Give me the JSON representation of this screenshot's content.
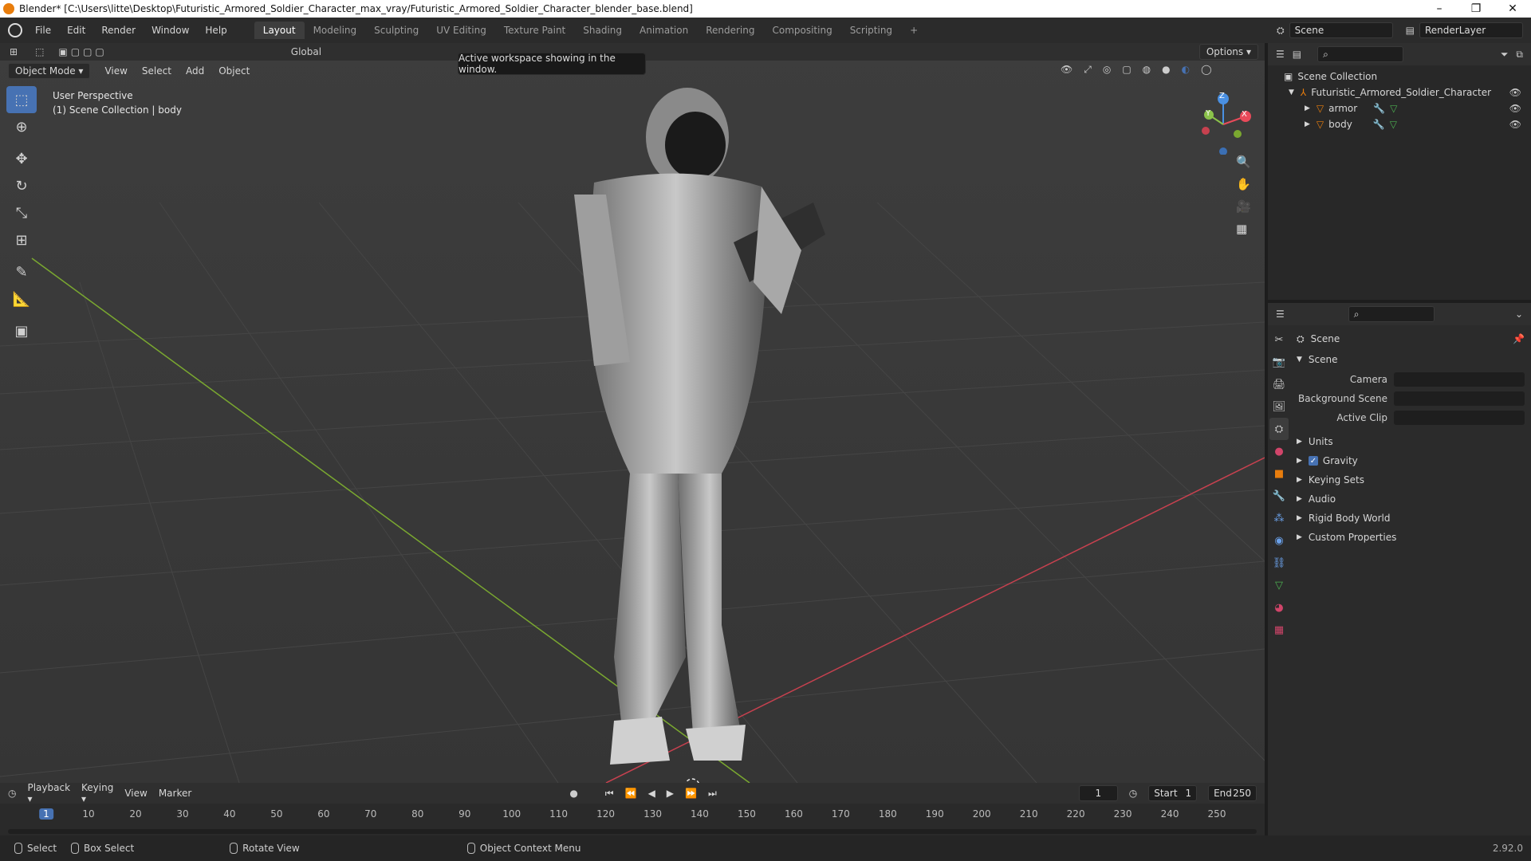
{
  "window": {
    "title": "Blender* [C:\\Users\\litte\\Desktop\\Futuristic_Armored_Soldier_Character_max_vray/Futuristic_Armored_Soldier_Character_blender_base.blend]",
    "minimize": "–",
    "restore": "❐",
    "close": "✕"
  },
  "menu": [
    "File",
    "Edit",
    "Render",
    "Window",
    "Help"
  ],
  "workspaces": [
    "Layout",
    "Modeling",
    "Sculpting",
    "UV Editing",
    "Texture Paint",
    "Shading",
    "Animation",
    "Rendering",
    "Compositing",
    "Scripting",
    "+"
  ],
  "scene_field": "Scene",
  "render_layer_field": "RenderLayer",
  "tooltip": "Active workspace showing in the window.",
  "viewport_header": {
    "mode": "Object Mode",
    "items": [
      "View",
      "Select",
      "Add",
      "Object"
    ],
    "options": "Options",
    "transform": "Global"
  },
  "viewport_overlay": {
    "perspective": "User Perspective",
    "collection": "(1) Scene Collection | body"
  },
  "gizmo": {
    "x": "X",
    "y": "Y",
    "z": "Z"
  },
  "outliner": {
    "root": "Scene Collection",
    "collection": "Futuristic_Armored_Soldier_Character",
    "objects": [
      "armor",
      "body"
    ]
  },
  "properties": {
    "context": "Scene",
    "section": "Scene",
    "fields": [
      {
        "label": "Camera"
      },
      {
        "label": "Background Scene"
      },
      {
        "label": "Active Clip"
      }
    ],
    "panels": [
      "Units",
      "Gravity",
      "Keying Sets",
      "Audio",
      "Rigid Body World",
      "Custom Properties"
    ],
    "gravity_checked": true
  },
  "timeline": {
    "menus": [
      "Playback",
      "Keying",
      "View",
      "Marker"
    ],
    "current_frame": "1",
    "start_label": "Start",
    "start": "1",
    "end_label": "End",
    "end": "250",
    "ticks": [
      "1",
      "10",
      "20",
      "30",
      "40",
      "50",
      "60",
      "70",
      "80",
      "90",
      "100",
      "110",
      "120",
      "130",
      "140",
      "150",
      "160",
      "170",
      "180",
      "190",
      "200",
      "210",
      "220",
      "230",
      "240",
      "250"
    ]
  },
  "statusbar": {
    "items": [
      "Select",
      "Box Select",
      "Rotate View",
      "Object Context Menu"
    ],
    "version": "2.92.0"
  },
  "colors": {
    "accent": "#4772b3",
    "x_axis": "#e94a5a",
    "y_axis": "#8bc34a",
    "z_axis": "#4a90e2",
    "orange": "#e87d0d"
  }
}
